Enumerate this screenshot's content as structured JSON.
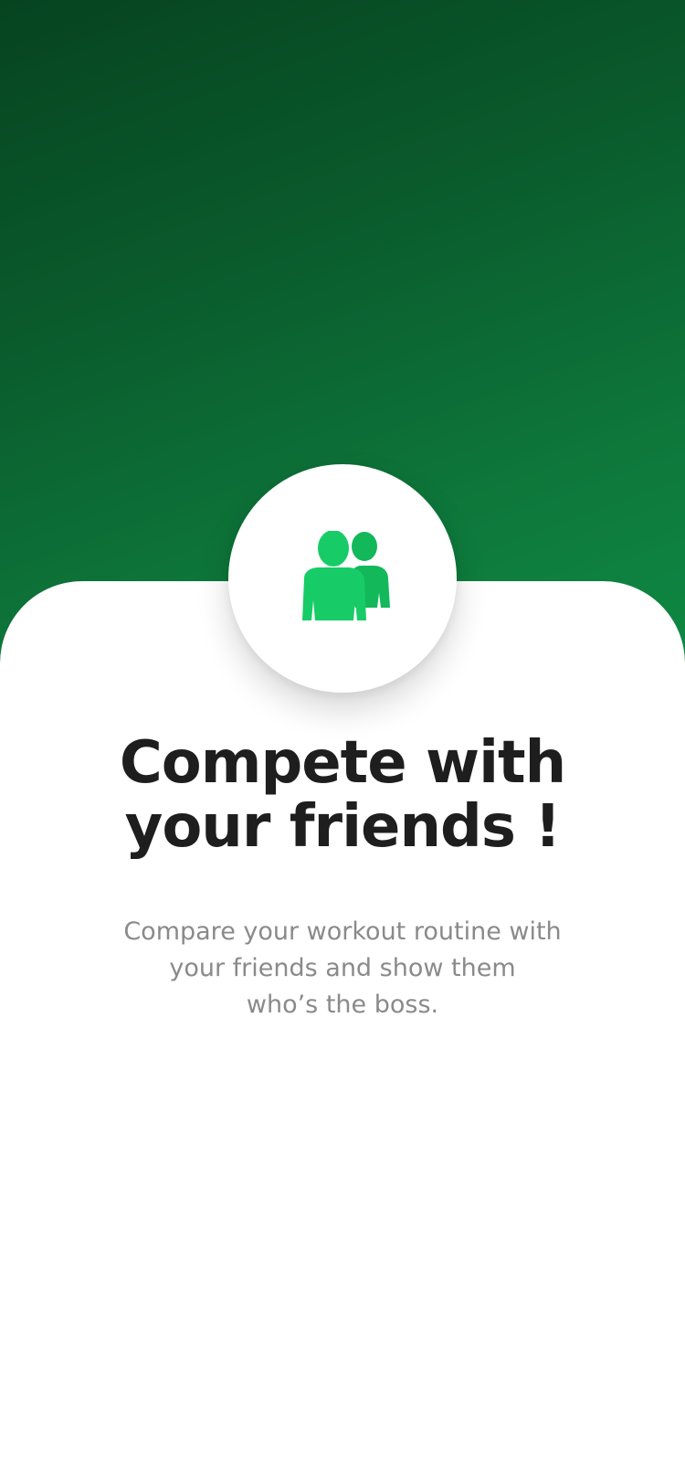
{
  "colors": {
    "hero_gradient_start": "#064420",
    "hero_gradient_end": "#0f8a44",
    "icon_green": "#17cc66",
    "title_color": "#1e1e1e",
    "subtitle_color": "#8a8a8a"
  },
  "onboarding": {
    "icon": "friends-icon",
    "title_line1": "Compete with",
    "title_line2": "your friends !",
    "description_line1": "Compare your workout routine with",
    "description_line2": "your friends and show them",
    "description_line3": "who’s the boss."
  }
}
